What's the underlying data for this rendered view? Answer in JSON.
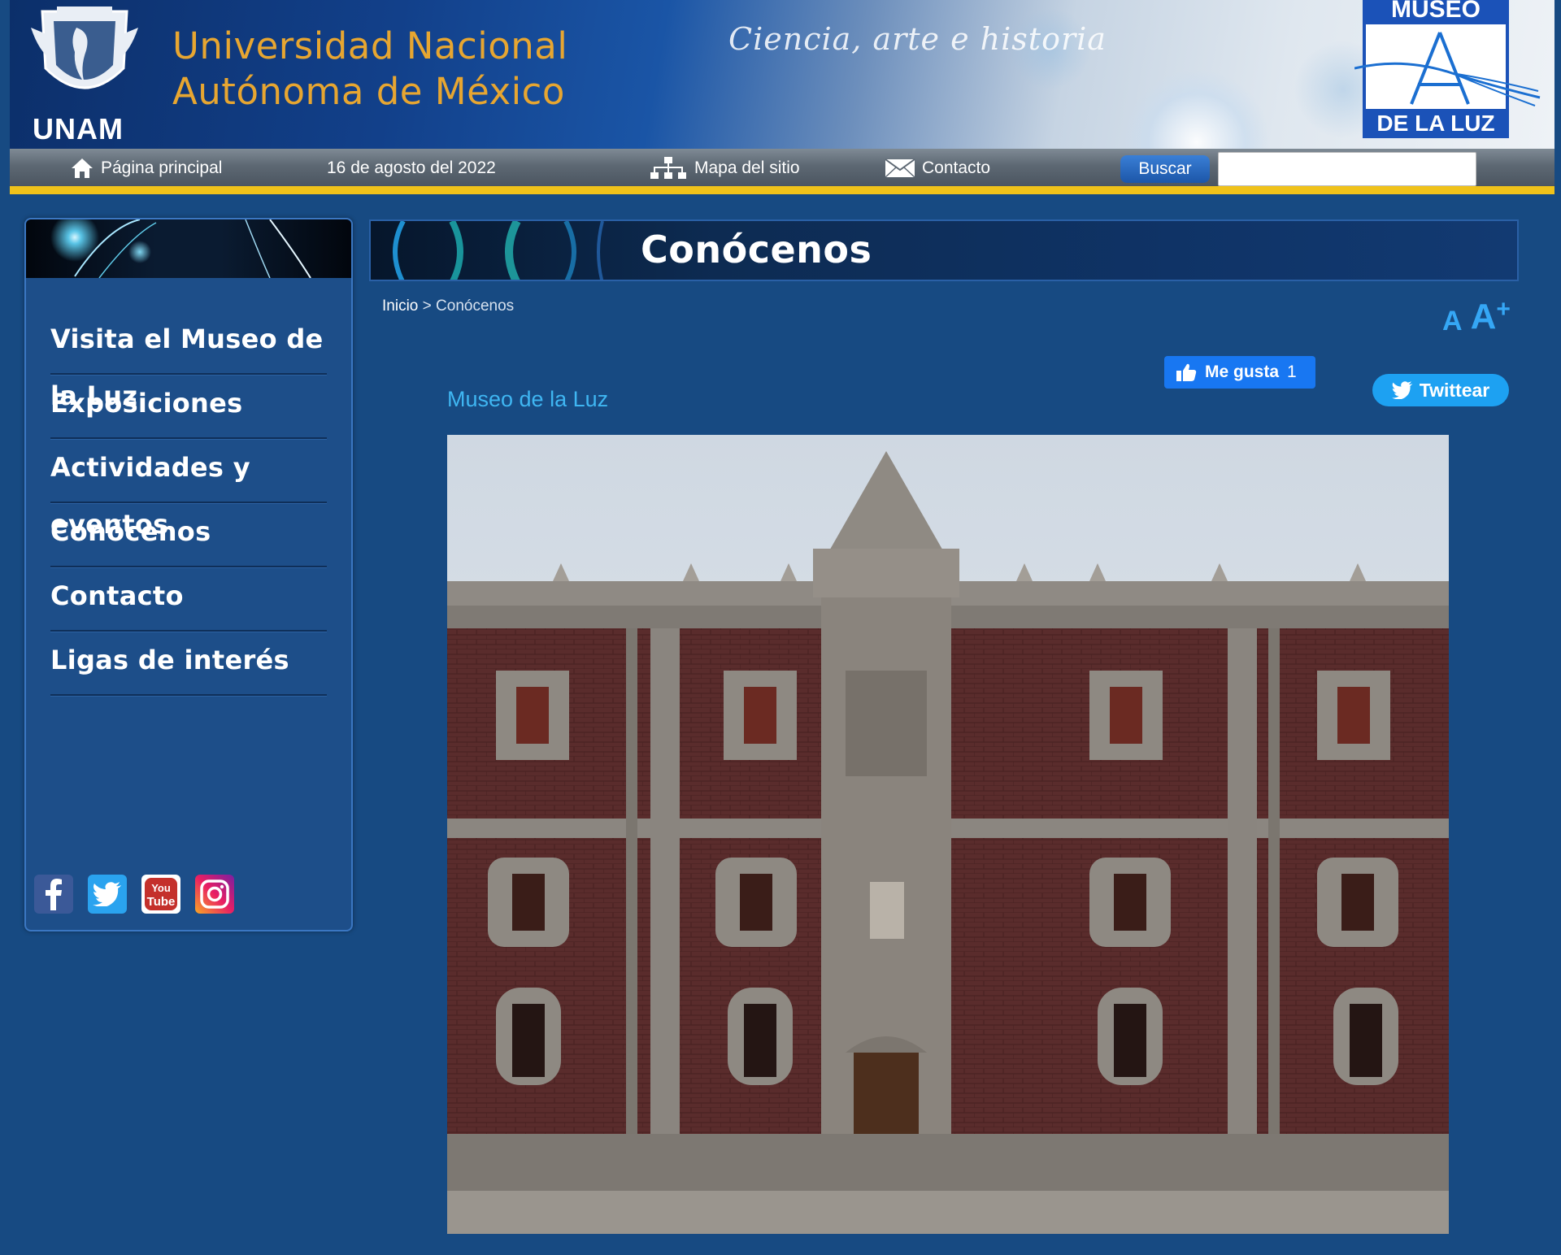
{
  "header": {
    "unam_label": "UNAM",
    "university_line1": "Universidad Nacional",
    "university_line2": "Autónoma de México",
    "tagline": "Ciencia, arte e historia",
    "museo_logo_top": "MUSEO",
    "museo_logo_bottom": "DE LA LUZ"
  },
  "navbar": {
    "home_label": "Página principal",
    "date": "16 de agosto del 2022",
    "sitemap_label": "Mapa del sitio",
    "contact_label": "Contacto",
    "search_button": "Buscar",
    "search_value": ""
  },
  "sidebar": {
    "items": [
      {
        "label": "Visita el Museo de la Luz"
      },
      {
        "label": "Exposiciones"
      },
      {
        "label": "Actividades y eventos"
      },
      {
        "label": "Conócenos"
      },
      {
        "label": "Contacto"
      },
      {
        "label": "Ligas de interés"
      }
    ],
    "social": [
      "facebook-icon",
      "twitter-icon",
      "youtube-icon",
      "instagram-icon"
    ]
  },
  "main": {
    "banner_title": "Conócenos",
    "breadcrumb": {
      "home": "Inicio",
      "separator": ">",
      "current": "Conócenos"
    },
    "font_small": "A",
    "font_large": "A",
    "font_large_sup": "+",
    "fb_like_label": "Me gusta",
    "fb_like_count": "1",
    "twitter_label": "Twittear",
    "heading": "Museo de la Luz"
  },
  "colors": {
    "page_bg": "#174a82",
    "accent_yellow": "#f0c21a",
    "heading_blue": "#3fb6f2",
    "header_gold": "#e7a631"
  }
}
